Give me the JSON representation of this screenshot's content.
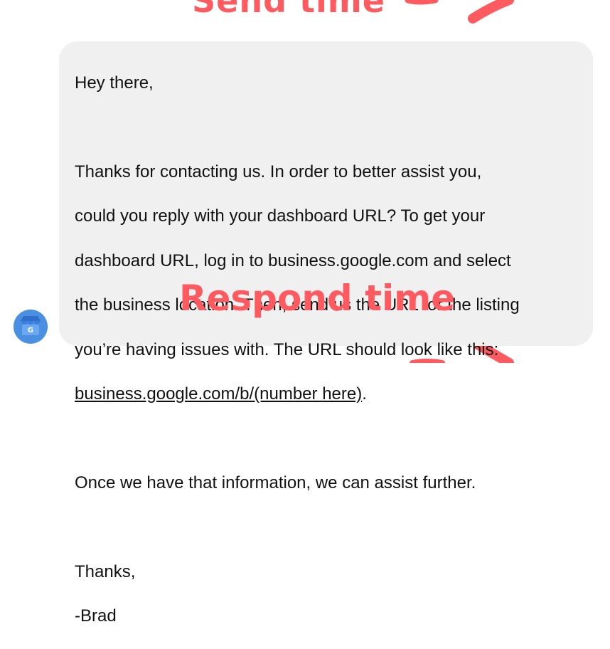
{
  "annotations": {
    "top_label": "Send time",
    "bottom_label": "Respond time",
    "color": "#ff5a5f"
  },
  "message": {
    "greeting": "Hey there,",
    "para1_lines": [
      "Thanks for contacting us. In order to better assist you,",
      "could you reply with your dashboard URL? To get your",
      "dashboard URL, log in to business.google.com and select",
      "the business location. Then, send us the URL for the listing",
      "you’re having issues with. The URL should look like this:"
    ],
    "link_text": "business.google.com/b/(number here)",
    "link_suffix": ".",
    "para2": "Once we have that information, we can assist further.",
    "signoff": "Thanks,",
    "signature": "-Brad"
  },
  "avatar": {
    "icon": "google-my-business-icon",
    "letter": "G",
    "bg_color": "#4a90e2"
  },
  "colors": {
    "bubble_bg": "#f0f0f0",
    "text": "#111111"
  }
}
